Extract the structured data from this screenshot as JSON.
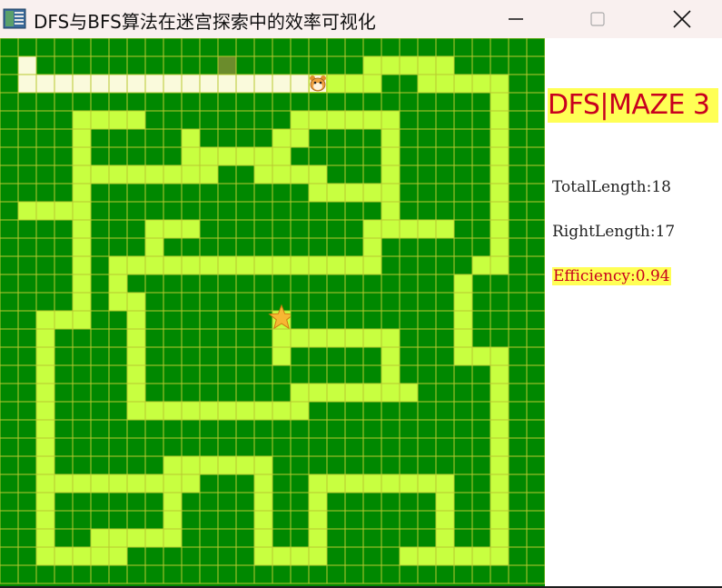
{
  "window": {
    "title": "DFS与BFS算法在迷宫探索中的效率可视化",
    "controls": {
      "minimize": "minimize",
      "maximize": "maximize",
      "close": "close"
    }
  },
  "panel": {
    "maze_title": "DFS|MAZE 3",
    "total_length": "TotalLength:18",
    "right_length": "RightLength:17",
    "efficiency": "Efficiency:0.94"
  },
  "colors": {
    "wall": "#008800",
    "grid_line": "#b8c830",
    "path": "#c8ff40",
    "visited": "#fafadc",
    "dead_end": "#6b8c2c",
    "accent": "#ffff55",
    "accent_text": "#c8001e"
  },
  "maze": {
    "cols": 30,
    "rows": 30,
    "rows_map": [
      "..............................",
      ".V..........D.......PPPPP.....",
      ".VVVVVVVVVVVVVVVVHPPP..PPPPP..",
      "...........................P..",
      "....PPPP........PPPPPP.....P..",
      "....P.....P....PP....P.....P..",
      "....P.....PPPPPP.....P.....P..",
      "....PPPPPPPP..PPPP...P.....P..",
      "....P............PPPPP.....P..",
      ".PPPP................P.....P..",
      "....P...PPP.........PPPPP..P..",
      "....P...P...........P......P..",
      "....P.PPPPPPPPPPPPPPP.....PP..",
      "....P.P..................P....",
      "....P.PP.................P....",
      "..PPP..P.......S.........P....",
      "..P....P.......PPPPPPP...P....",
      "..P....P.......P.....P...PPP..",
      "..P....P.............P.....P..",
      "..P....P........PPPPPPP....P..",
      "..P....PPPPPPPPPP..........P..",
      "..P........................P..",
      "..P........................P..",
      "..P......PPPPPP............P..",
      "..PPPPPPPPP...P..PPPPPPPP..P..",
      "..P......P....P..P......P..P..",
      "..P......P....P..P......P..P..",
      "..P..PPPPP....P..P......P..P..",
      "..PPPPP.......PPPP....PPPPPP..",
      ".............................."
    ],
    "legend": {
      ".": "wall",
      "P": "path",
      "V": "visited",
      "D": "dead_end",
      "H": "hamster",
      "S": "star"
    },
    "player_icon": "hamster-icon",
    "goal_icon": "star-icon"
  }
}
